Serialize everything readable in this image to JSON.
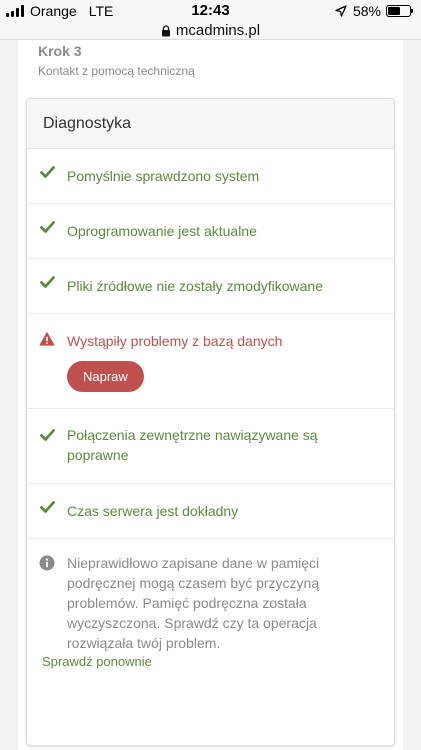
{
  "status_bar": {
    "carrier": "Orange",
    "network": "LTE",
    "time": "12:43",
    "battery": "58%",
    "battery_level": 0.58
  },
  "browser": {
    "url": "mcadmins.pl"
  },
  "step": {
    "title": "Krok 3",
    "subtitle": "Kontakt z pomocą techniczną"
  },
  "diagnostics": {
    "title": "Diagnostyka",
    "items": [
      {
        "status": "ok",
        "text": "Pomyślnie sprawdzono system"
      },
      {
        "status": "ok",
        "text": "Oprogramowanie jest aktualne"
      },
      {
        "status": "ok",
        "text": "Pliki źródłowe nie zostały zmodyfikowane"
      },
      {
        "status": "error",
        "text": "Wystąpiły problemy z bazą danych",
        "action": "Napraw"
      },
      {
        "status": "ok",
        "text": "Połączenia zewnętrzne nawiązywane są poprawne"
      },
      {
        "status": "ok",
        "text": "Czas serwera jest dokładny"
      }
    ],
    "info": "Nieprawidłowo zapisane dane w pamięci podręcznej mogą czasem być przyczyną problemów. Pamięć podręczna została wyczyszczona. Sprawdź czy ta operacja rozwiązała twój problem.",
    "recheck_label": "Sprawdź ponownie"
  },
  "colors": {
    "success": "#5a8c3a",
    "error": "#c0504d",
    "muted": "#8a8a8a"
  }
}
